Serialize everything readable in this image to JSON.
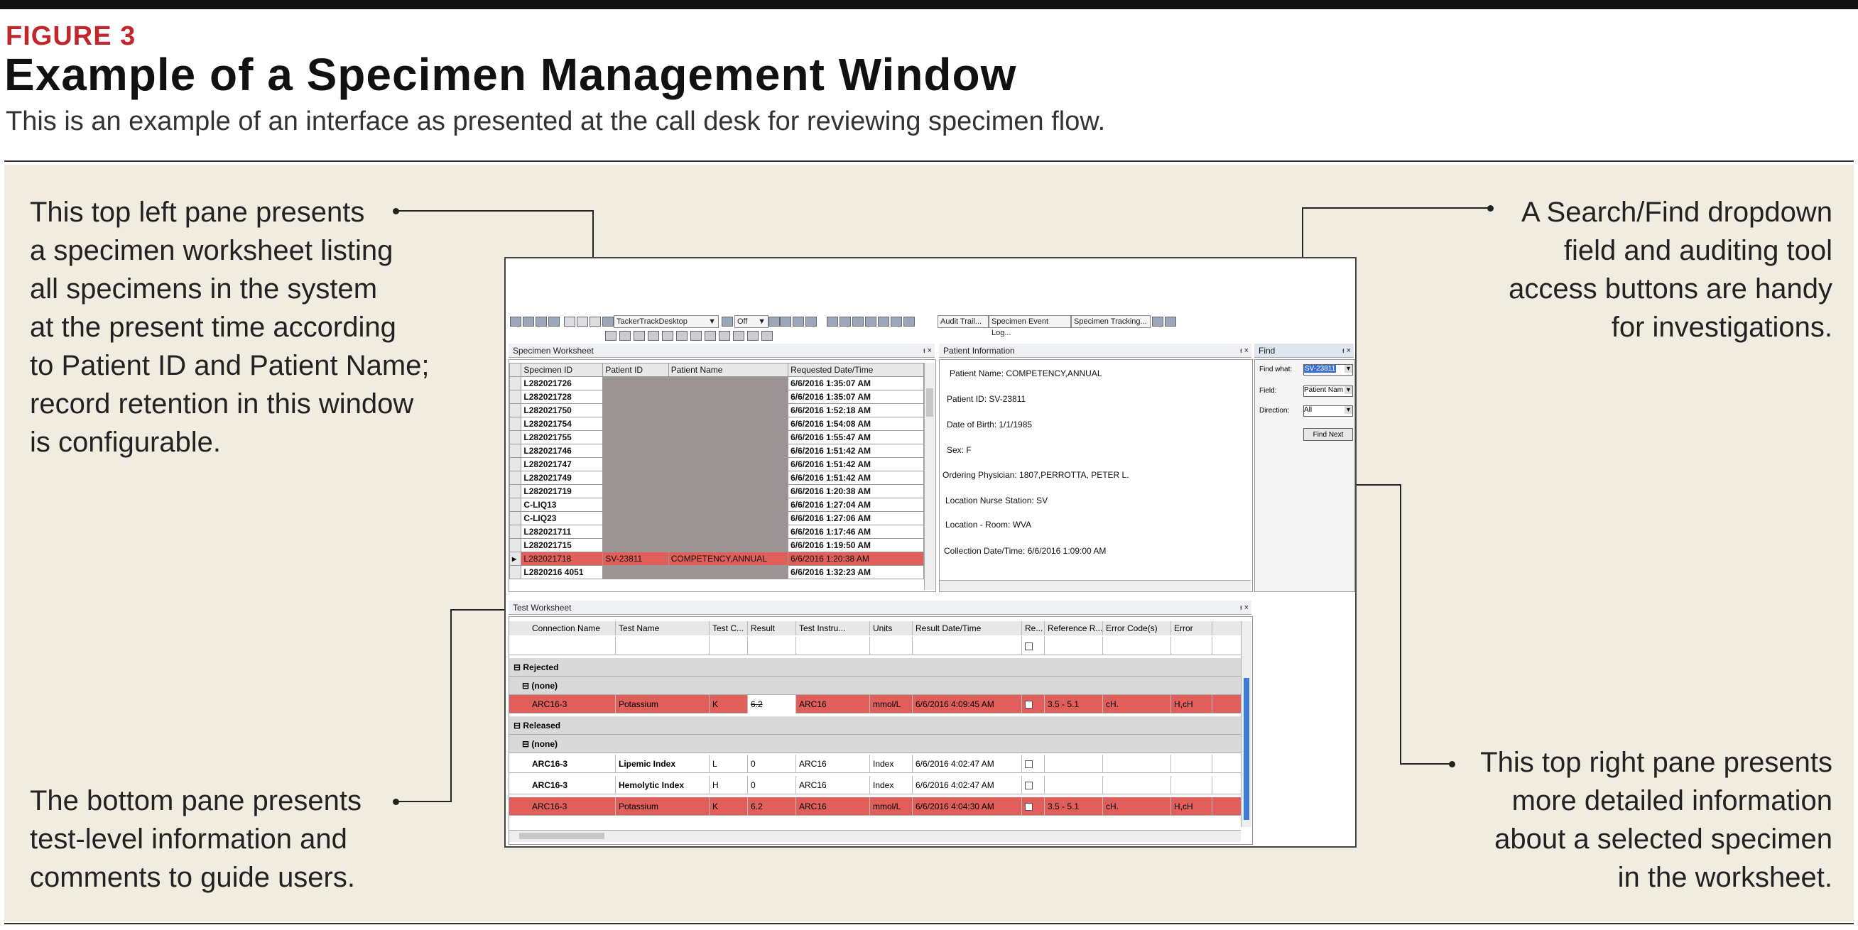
{
  "figure": {
    "label": "FIGURE 3",
    "title": "Example of a Specimen Management Window",
    "subtitle": "This is an example of an interface as presented at the call desk for reviewing specimen flow."
  },
  "callouts": {
    "top_left": [
      "This top left pane presents",
      "a specimen worksheet listing",
      "all specimens in the system",
      "at the present time according",
      "to Patient ID and Patient Name;",
      "record retention in this window",
      "is configurable."
    ],
    "top_right": [
      "A Search/Find dropdown",
      "field and auditing tool",
      "access buttons are handy",
      "for investigations."
    ],
    "bottom_left": [
      "The bottom pane presents",
      "test-level information and",
      "comments to guide users."
    ],
    "bottom_right": [
      "This top right pane presents",
      "more detailed information",
      "about a selected specimen",
      "in the worksheet."
    ]
  },
  "toolbar": {
    "desktop_select": "TackerTrackDesktop",
    "off_select": "Off",
    "audit_trail": "Audit Trail...",
    "event_log": "Specimen Event Log...",
    "tracking": "Specimen Tracking..."
  },
  "specimen_worksheet": {
    "title": "Specimen Worksheet",
    "columns": [
      "Specimen ID",
      "Patient ID",
      "Patient Name",
      "Requested Date/Time"
    ],
    "rows": [
      {
        "id": "L282021726",
        "pid": "",
        "pname": "",
        "dt": "6/6/2016 1:35:07 AM"
      },
      {
        "id": "L282021728",
        "pid": "",
        "pname": "",
        "dt": "6/6/2016 1:35:07 AM"
      },
      {
        "id": "L282021750",
        "pid": "",
        "pname": "",
        "dt": "6/6/2016 1:52:18 AM"
      },
      {
        "id": "L282021754",
        "pid": "",
        "pname": "",
        "dt": "6/6/2016 1:54:08 AM"
      },
      {
        "id": "L282021755",
        "pid": "",
        "pname": "",
        "dt": "6/6/2016 1:55:47 AM"
      },
      {
        "id": "L282021746",
        "pid": "",
        "pname": "",
        "dt": "6/6/2016 1:51:42 AM"
      },
      {
        "id": "L282021747",
        "pid": "",
        "pname": "",
        "dt": "6/6/2016 1:51:42 AM"
      },
      {
        "id": "L282021749",
        "pid": "",
        "pname": "",
        "dt": "6/6/2016 1:51:42 AM"
      },
      {
        "id": "L282021719",
        "pid": "",
        "pname": "",
        "dt": "6/6/2016 1:20:38 AM"
      },
      {
        "id": "C-LIQ13",
        "pid": "",
        "pname": "",
        "dt": "6/6/2016 1:27:04 AM"
      },
      {
        "id": "C-LIQ23",
        "pid": "",
        "pname": "",
        "dt": "6/6/2016 1:27:06 AM"
      },
      {
        "id": "L282021711",
        "pid": "",
        "pname": "",
        "dt": "6/6/2016 1:17:46 AM"
      },
      {
        "id": "L282021715",
        "pid": "",
        "pname": "",
        "dt": "6/6/2016 1:19:50 AM"
      },
      {
        "id": "L282021718",
        "pid": "SV-23811",
        "pname": "COMPETENCY,ANNUAL",
        "dt": "6/6/2016 1:20:38 AM",
        "selected": true
      },
      {
        "id": "L2820216 4051",
        "pid": "",
        "pname": "",
        "dt": "6/6/2016 1:32:23 AM"
      }
    ]
  },
  "patient_info": {
    "title": "Patient Information",
    "lines": [
      "Patient Name:  COMPETENCY,ANNUAL",
      "Patient ID:  SV-23811",
      "Date of Birth:  1/1/1985",
      "Sex:  F",
      "Ordering Physician:  1807,PERROTTA, PETER L.",
      "Location Nurse Station:  SV",
      "Location - Room:  WVA",
      "Collection Date/Time:  6/6/2016 1:09:00 AM"
    ]
  },
  "find": {
    "title": "Find",
    "find_what_label": "Find what:",
    "find_what_value": "SV-23811",
    "field_label": "Field:",
    "field_value": "Patient Nam",
    "direction_label": "Direction:",
    "direction_value": "All",
    "find_next": "Find Next"
  },
  "test_worksheet": {
    "title": "Test Worksheet",
    "columns": [
      "Connection Name",
      "Test Name",
      "Test C...",
      "Result",
      "Test Instru...",
      "Units",
      "Result Date/Time",
      "Re...",
      "Reference R...",
      "Error Code(s)",
      "Error"
    ],
    "group_rejected": "Rejected",
    "group_released": "Released",
    "none_label": "(none)",
    "rejected_rows": [
      [
        "ARC16-3",
        "Potassium",
        "K",
        "6.2",
        "ARC16",
        "mmol/L",
        "6/6/2016 4:09:45 AM",
        "",
        "3.5 - 5.1",
        "cH.",
        "H,cH"
      ]
    ],
    "released_rows": [
      [
        "ARC16-3",
        "Lipemic Index",
        "L",
        "0",
        "ARC16",
        "Index",
        "6/6/2016 4:02:47 AM",
        "",
        "",
        "",
        ""
      ],
      [
        "ARC16-3",
        "Hemolytic Index",
        "H",
        "0",
        "ARC16",
        "Index",
        "6/6/2016 4:02:47 AM",
        "",
        "",
        "",
        ""
      ],
      [
        "ARC16-3",
        "Potassium",
        "K",
        "6.2",
        "ARC16",
        "mmol/L",
        "6/6/2016 4:04:30 AM",
        "",
        "3.5 - 5.1",
        "cH.",
        "H,cH"
      ]
    ]
  }
}
